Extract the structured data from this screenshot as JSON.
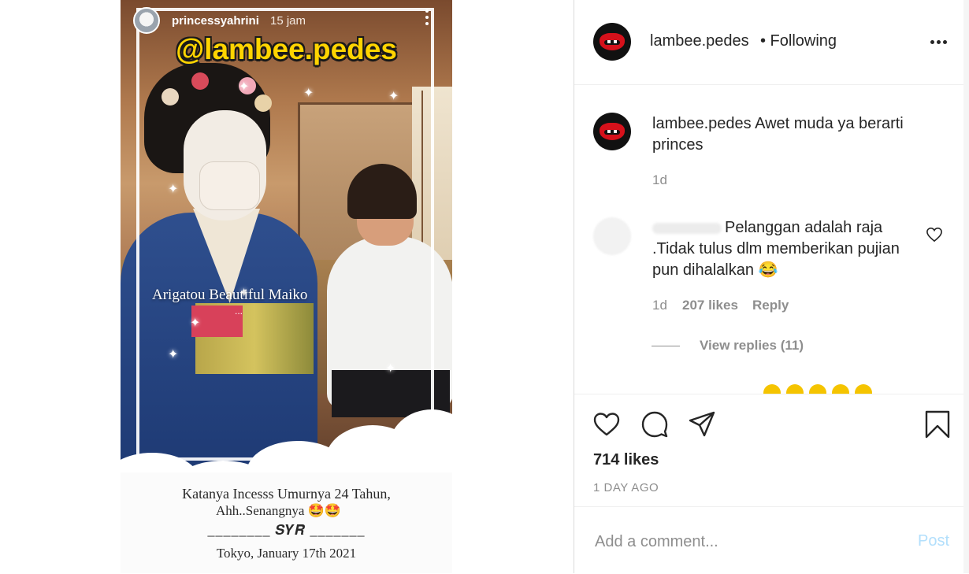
{
  "story": {
    "username": "princessyahrini",
    "time": "15 jam",
    "watermark": "@lambee.pedes",
    "overlay_text": "Arigatou Beautiful Maiko",
    "overlay_dots": "...",
    "caption_line1": "Katanya Incesss Umurnya 24 Tahun,",
    "caption_line2": "Ahh..Senangnya 🤩🤩",
    "caption_line3": "________ 𝑺𝒀𝑹 _______",
    "caption_line4": "Tokyo, January 17th 2021"
  },
  "post": {
    "username": "lambee.pedes",
    "following": "• Following",
    "caption_user": "lambee.pedes",
    "caption_text": "Awet muda ya berarti princes",
    "caption_time": "1d",
    "comments": [
      {
        "text": "Pelanggan adalah raja .Tidak tulus dlm memberikan pujian pun dihalalkan 😂",
        "time": "1d",
        "likes": "207 likes",
        "reply": "Reply",
        "view_replies": "View replies (11)"
      }
    ],
    "likes": "714 likes",
    "date": "1 DAY AGO",
    "comment_placeholder": "Add a comment...",
    "post_label": "Post"
  },
  "icons": {
    "like": "heart-icon",
    "comment": "comment-icon",
    "share": "paper-plane-icon",
    "save": "bookmark-icon",
    "more": "more-horizontal-icon"
  },
  "colors": {
    "brand_red": "#d6111b",
    "watermark_yellow": "#ffd400",
    "post_button_disabled": "#b2dffc",
    "muted_text": "#8e8e8e"
  }
}
